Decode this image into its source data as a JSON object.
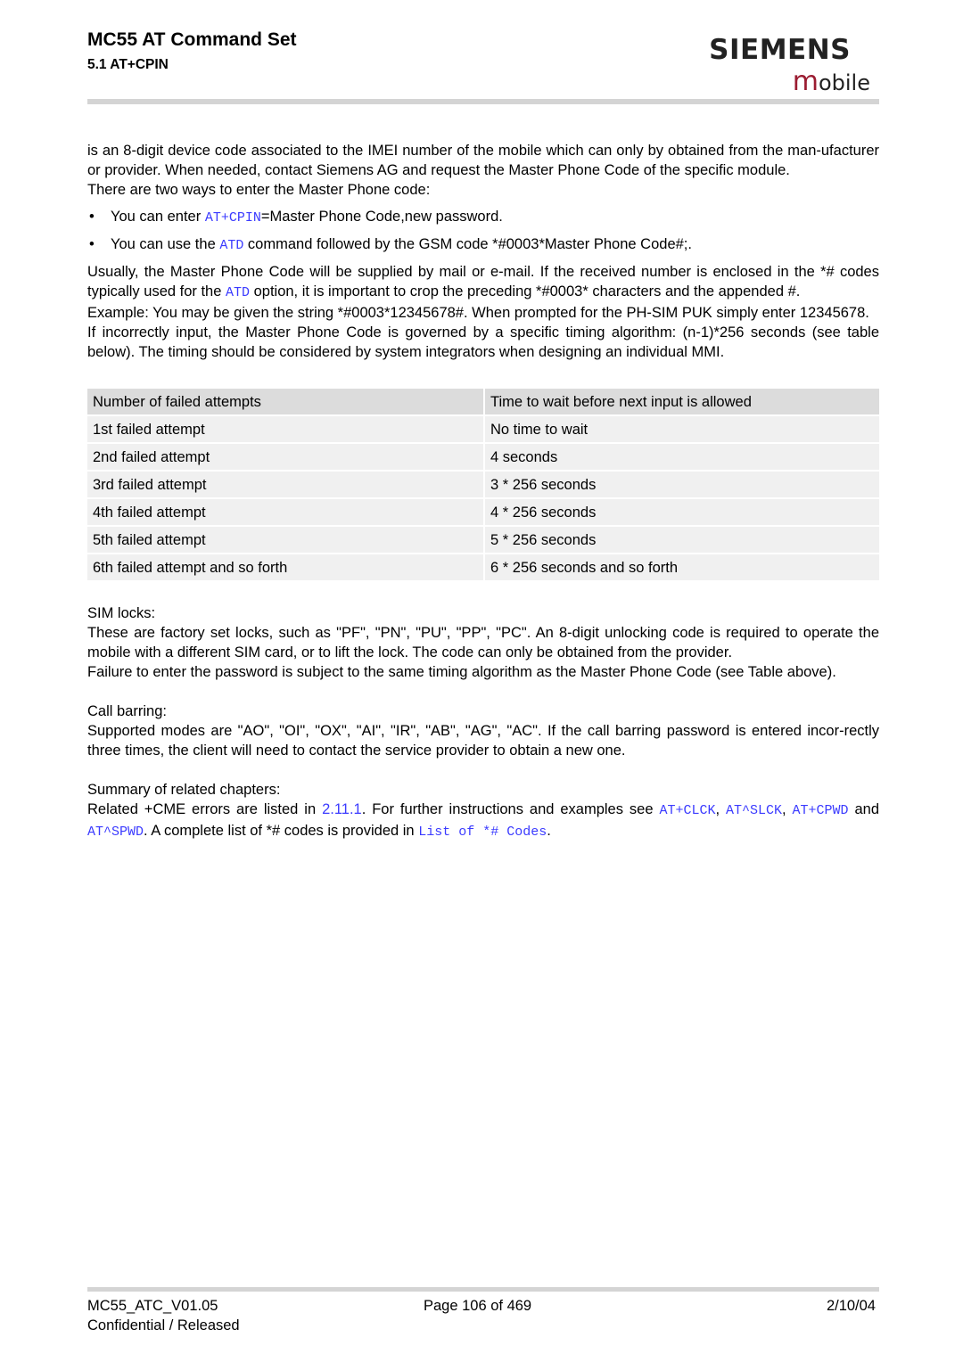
{
  "header": {
    "title": "MC55 AT Command Set",
    "section": "5.1 AT+CPIN",
    "logo": {
      "brand": "SIEMENS",
      "sub_first": "m",
      "sub_rest": "obile",
      "accent_color": "#9b1c31"
    }
  },
  "body": {
    "intro": "is an 8-digit device code associated to the IMEI number of the mobile which can only by obtained from the man-ufacturer or provider. When needed, contact Siemens AG and request the Master Phone Code of the specific module.",
    "two_ways": "There are two ways to enter the Master Phone code:",
    "bullets": [
      {
        "pre": "You can enter ",
        "code": "AT+CPIN",
        "post": "=Master Phone Code,new password."
      },
      {
        "pre": "You can use the ",
        "code": "ATD",
        "post": " command followed by the GSM code *#0003*Master Phone Code#;."
      }
    ],
    "usually": {
      "pre": "Usually, the Master Phone Code will be supplied by mail or e-mail. If the received number is enclosed in the *# codes typically used for the ",
      "code": "ATD",
      "post": " option, it is important to crop the preceding *#0003* characters and the appended #."
    },
    "example": "Example: You may be given the string *#0003*12345678#. When prompted for the PH-SIM PUK simply enter 12345678.",
    "incorrect": "If incorrectly input, the Master Phone Code is governed by a specific timing algorithm: (n-1)*256 seconds (see table below). The timing should be considered by system integrators when designing an individual MMI.",
    "table": {
      "headers": [
        "Number of failed attempts",
        "Time to wait before next input is allowed"
      ],
      "rows": [
        [
          "1st failed attempt",
          "No time to wait"
        ],
        [
          "2nd failed attempt",
          "4 seconds"
        ],
        [
          "3rd failed attempt",
          "3 * 256 seconds"
        ],
        [
          "4th failed attempt",
          "4 * 256 seconds"
        ],
        [
          "5th failed attempt",
          "5 * 256 seconds"
        ],
        [
          "6th failed attempt and so forth",
          "6 * 256 seconds and so forth"
        ]
      ]
    },
    "sim_locks_label": "SIM locks:",
    "sim_locks_text": "These are factory set locks, such as \"PF\", \"PN\", \"PU\", \"PP\", \"PC\". An 8-digit unlocking code is required to operate the mobile with a different SIM card, or to lift the lock. The code can only be obtained from the provider.",
    "sim_locks_failure": "Failure to enter the password is subject to the same timing algorithm as the Master Phone Code (see Table above).",
    "call_barring_label": "Call barring:",
    "call_barring_text": "Supported modes are \"AO\", \"OI\", \"OX\", \"AI\", \"IR\", \"AB\", \"AG\", \"AC\". If the call barring password is entered incor-rectly three times, the client will need to contact the service provider to obtain a new one.",
    "summary_label": "Summary of related chapters:",
    "summary": {
      "t1": "Related +CME errors are listed in ",
      "link_section": "2.11.1",
      "t2": ". For further instructions and examples see ",
      "link_clck": "AT+CLCK",
      "t3": ", ",
      "link_slck": "AT^SLCK",
      "t4": ", ",
      "link_cpwd": "AT+CPWD",
      "t5": " and ",
      "link_spwd": "AT^SPWD",
      "t6": ". A complete list of *# codes is provided in ",
      "link_codes": "List of *# Codes",
      "t7": "."
    }
  },
  "footer": {
    "doc_id": "MC55_ATC_V01.05",
    "page": "Page 106 of 469",
    "date": "2/10/04",
    "classification": "Confidential / Released"
  },
  "colors": {
    "link": "#3b3bff",
    "table_header_bg": "#dcdcdc",
    "table_row_bg": "#f0f0f0",
    "rule": "#d4d4d4"
  }
}
